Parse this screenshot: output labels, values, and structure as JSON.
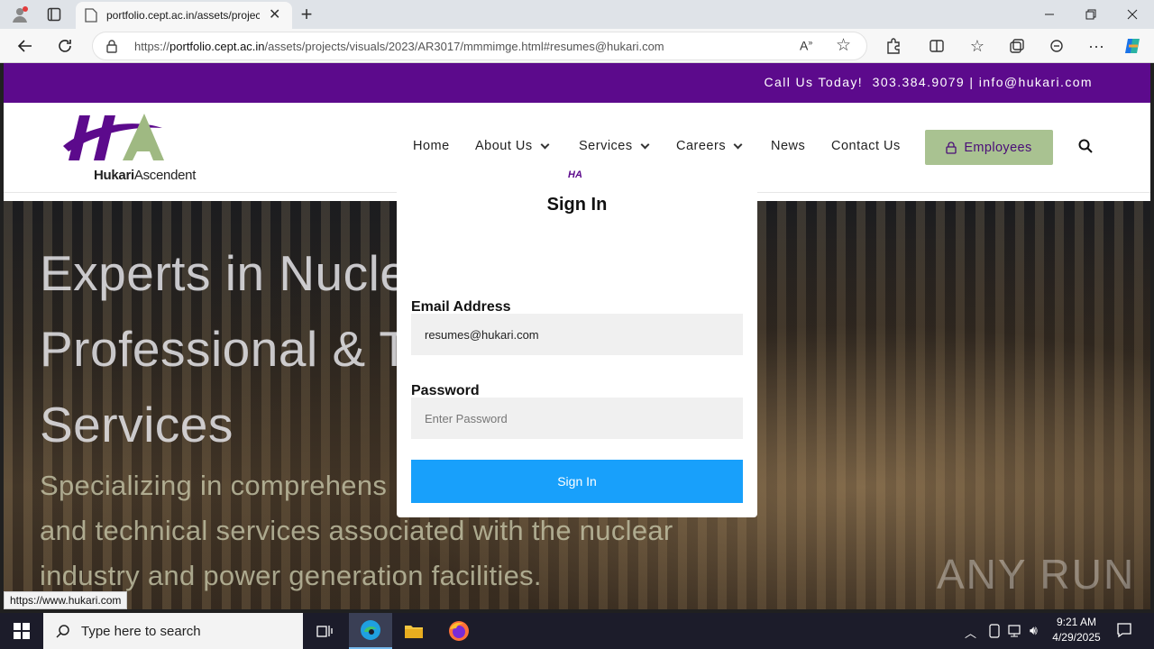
{
  "browser": {
    "tab_title": "portfolio.cept.ac.in/assets/projec",
    "url_prefix": "https://",
    "url_domain": "portfolio.cept.ac.in",
    "url_path": "/assets/projects/visuals/2023/AR3017/mmmimge.html#resumes@hukari.com"
  },
  "site": {
    "contact_strip": "Call Us Today!  303.384.9079 | info@hukari.com",
    "logo_brand_bold": "Hukari",
    "logo_brand_light": "Ascendent",
    "logo_mark": "HA",
    "brand_colors": {
      "purple": "#5c0a8c",
      "green": "#a9c291"
    },
    "nav": {
      "home": "Home",
      "about": "About Us",
      "services": "Services",
      "careers": "Careers",
      "news": "News",
      "contact": "Contact Us",
      "employees": "Employees"
    },
    "hero": {
      "line1": "Experts in Nucle",
      "line2": "Professional & T",
      "line3": "Services",
      "sub1": "Specializing in comprehens",
      "sub2": "and technical services associated with the nuclear",
      "sub3": "industry and power generation facilities."
    },
    "watermark": "ANY RUN"
  },
  "modal": {
    "title": "Sign In",
    "email_label": "Email Address",
    "email_value": "resumes@hukari.com",
    "password_label": "Password",
    "password_placeholder": "Enter Password",
    "submit_label": "Sign In"
  },
  "status_url": "https://www.hukari.com",
  "taskbar": {
    "search_placeholder": "Type here to search",
    "time": "9:21 AM",
    "date": "4/29/2025"
  }
}
